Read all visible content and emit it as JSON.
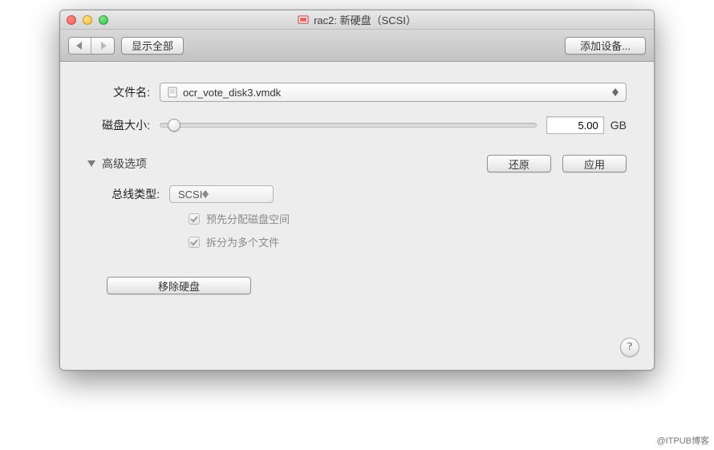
{
  "titlebar": {
    "title": "rac2: 新硬盘（SCSI）"
  },
  "toolbar": {
    "show_all_label": "显示全部",
    "add_device_label": "添加设备..."
  },
  "file": {
    "label": "文件名:",
    "value": "ocr_vote_disk3.vmdk"
  },
  "disk_size": {
    "label": "磁盘大小:",
    "value": "5.00",
    "unit": "GB"
  },
  "advanced": {
    "title": "高级选项",
    "restore_label": "还原",
    "apply_label": "应用",
    "bus_type_label": "总线类型:",
    "bus_type_value": "SCSI",
    "preallocate_label": "预先分配磁盘空间",
    "split_label": "拆分为多个文件"
  },
  "remove_label": "移除硬盘",
  "help_label": "?",
  "watermark": "@ITPUB博客"
}
